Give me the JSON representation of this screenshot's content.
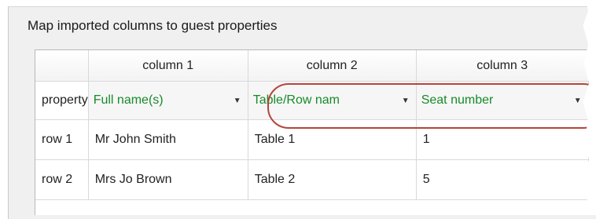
{
  "dialog": {
    "group_title": "Map imported columns to guest properties"
  },
  "table": {
    "columns": [
      "column 1",
      "column 2",
      "column 3"
    ],
    "property_row": {
      "label": "property",
      "values": [
        "Full name(s)",
        "Table/Row nam",
        "Seat number"
      ]
    },
    "rows": [
      {
        "label": "row 1",
        "cells": [
          "Mr John Smith",
          "Table 1",
          "1"
        ]
      },
      {
        "label": "row 2",
        "cells": [
          "Mrs Jo Brown",
          "Table 2",
          "5"
        ]
      }
    ]
  },
  "colors": {
    "property_text": "#178a2a",
    "callout": "#b5443c"
  }
}
